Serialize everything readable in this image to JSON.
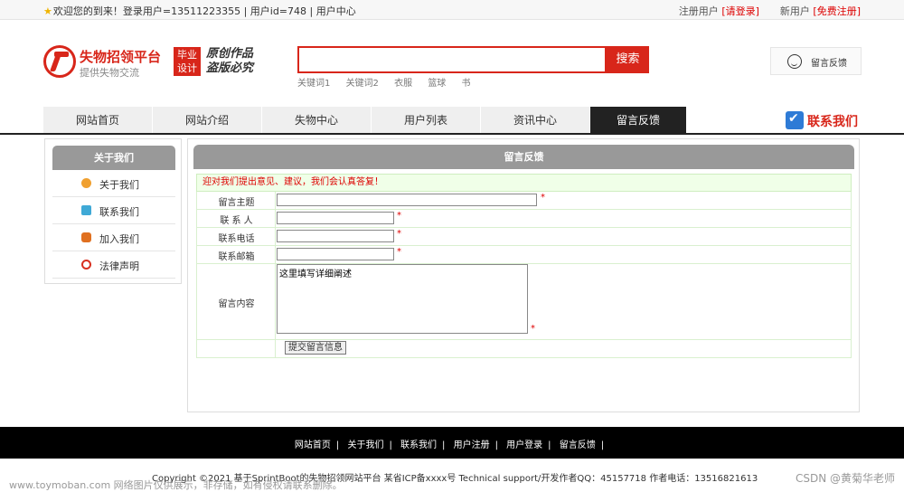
{
  "topbar": {
    "welcome": "欢迎您的到来！登录用户=13511223355 | 用户id=748 | 用户中心",
    "register_user": "注册用户",
    "please_login": "[请登录]",
    "new_user": "新用户",
    "free_register": "[免费注册]"
  },
  "logo": {
    "title": "失物招领平台",
    "subtitle": "提供失物交流",
    "badge_line1": "毕业",
    "badge_line2": "设计",
    "slogan_line1": "原创作品",
    "slogan_line2": "盗版必究"
  },
  "search": {
    "value": "",
    "button": "搜索",
    "keywords": [
      "关键词1",
      "关键词2",
      "衣服",
      "篮球",
      "书"
    ]
  },
  "feedback_box": {
    "label": "留言反馈"
  },
  "nav": {
    "items": [
      "网站首页",
      "网站介绍",
      "失物中心",
      "用户列表",
      "资讯中心",
      "留言反馈"
    ],
    "active_index": 5
  },
  "contact_us": "联系我们",
  "sidebar": {
    "title": "关于我们",
    "items": [
      {
        "label": "关于我们",
        "icon": "about-icon",
        "color": "#f0a030"
      },
      {
        "label": "联系我们",
        "icon": "contact-icon",
        "color": "#3fa9d6"
      },
      {
        "label": "加入我们",
        "icon": "lock-icon",
        "color": "#e07020"
      },
      {
        "label": "法律声明",
        "icon": "power-icon",
        "color": "#d83020"
      }
    ]
  },
  "form": {
    "title": "留言反馈",
    "notice": "迎对我们提出意见、建议，我们会认真答复！",
    "fields": {
      "subject_label": "留言主题",
      "contact_label": "联 系 人",
      "phone_label": "联系电话",
      "email_label": "联系邮箱",
      "content_label": "留言内容",
      "required_mark": "*",
      "content_value": "这里填写详细阐述"
    },
    "submit": "提交留言信息"
  },
  "footer": {
    "links": [
      "网站首页",
      "关于我们",
      "联系我们",
      "用户注册",
      "用户登录",
      "留言反馈"
    ],
    "separator": "|",
    "copyright": "Copyright ©2021 基于SprintBoot的失物招领网站平台   某省ICP备xxxx号   Technical support/开发作者QQ：45157718    作者电话：13516821613"
  },
  "watermarks": {
    "left": "www.toymoban.com 网络图片仅供展示，非存储，如有侵权请联系删除。",
    "right": "CSDN @黄菊华老师"
  }
}
